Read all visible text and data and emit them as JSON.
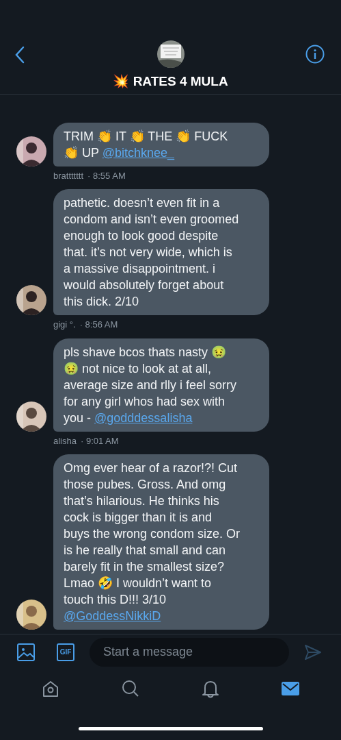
{
  "header": {
    "title": "💥 RATES 4 MULA"
  },
  "messages": [
    {
      "lines": [
        [
          {
            "kind": "text",
            "text": "TRIM 👏 IT 👏 THE 👏 FUCK"
          }
        ],
        [
          {
            "kind": "text",
            "text": "👏 UP "
          },
          {
            "kind": "mention",
            "text": "@bitchknee_"
          }
        ]
      ],
      "sender": "brattttttt",
      "time": "· 8:55 AM"
    },
    {
      "lines": [
        [
          {
            "kind": "text",
            "text": "pathetic. doesn’t even fit in a"
          }
        ],
        [
          {
            "kind": "text",
            "text": "condom and isn’t even groomed"
          }
        ],
        [
          {
            "kind": "text",
            "text": "enough to look good despite"
          }
        ],
        [
          {
            "kind": "text",
            "text": "that. it’s not very wide, which is"
          }
        ],
        [
          {
            "kind": "text",
            "text": "a massive disappointment. i"
          }
        ],
        [
          {
            "kind": "text",
            "text": "would absolutely forget about"
          }
        ],
        [
          {
            "kind": "text",
            "text": "this dick. 2/10"
          }
        ]
      ],
      "sender": "gigi °.",
      "time": "· 8:56 AM"
    },
    {
      "lines": [
        [
          {
            "kind": "text",
            "text": "pls shave bcos thats nasty 🤢"
          }
        ],
        [
          {
            "kind": "text",
            "text": "🤢 not nice to look at at all,"
          }
        ],
        [
          {
            "kind": "text",
            "text": "average size and rlly i feel sorry"
          }
        ],
        [
          {
            "kind": "text",
            "text": "for any girl whos had sex with"
          }
        ],
        [
          {
            "kind": "text",
            "text": "you - "
          },
          {
            "kind": "mention",
            "text": "@godddessalisha"
          }
        ]
      ],
      "sender": "alisha",
      "time": "· 9:01 AM"
    },
    {
      "lines": [
        [
          {
            "kind": "text",
            "text": "Omg ever hear of a razor!?! Cut"
          }
        ],
        [
          {
            "kind": "text",
            "text": "those pubes. Gross. And omg"
          }
        ],
        [
          {
            "kind": "text",
            "text": "that’s hilarious. He thinks his"
          }
        ],
        [
          {
            "kind": "text",
            "text": "cock is bigger than it is and"
          }
        ],
        [
          {
            "kind": "text",
            "text": "buys the wrong condom size. Or"
          }
        ],
        [
          {
            "kind": "text",
            "text": "is he really that small and can"
          }
        ],
        [
          {
            "kind": "text",
            "text": "barely fit in the smallest size?"
          }
        ],
        [
          {
            "kind": "text",
            "text": "Lmao 🤣   I wouldn’t want to"
          }
        ],
        [
          {
            "kind": "text",
            "text": "touch this D!!!  3/10"
          }
        ],
        [
          {
            "kind": "mention",
            "text": "@GoddessNikkiD"
          }
        ]
      ]
    }
  ],
  "composer": {
    "gif_label": "GIF",
    "placeholder": "Start a message"
  },
  "tab_bar": [
    {
      "kind": "home",
      "selected": false
    },
    {
      "kind": "search",
      "selected": false
    },
    {
      "kind": "notifications",
      "selected": false
    },
    {
      "kind": "messages",
      "selected": true
    }
  ]
}
